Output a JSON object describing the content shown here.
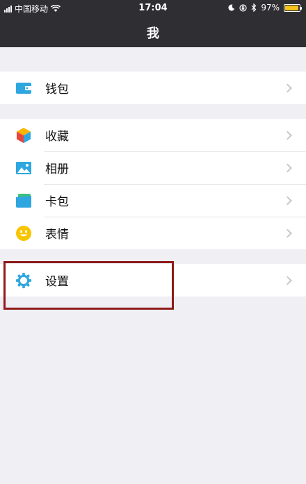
{
  "status_bar": {
    "carrier": "中国移动",
    "time": "17:04",
    "battery_percent": "97%",
    "battery_level": 0.97,
    "icons": [
      "signal-icon",
      "wifi-icon",
      "moon-icon",
      "rotation-lock-icon",
      "bluetooth-icon",
      "battery-icon"
    ]
  },
  "nav": {
    "title": "我"
  },
  "menu": {
    "wallet": {
      "label": "钱包",
      "icon": "wallet-icon"
    },
    "items": [
      {
        "label": "收藏",
        "icon": "favorites-cube-icon"
      },
      {
        "label": "相册",
        "icon": "album-picture-icon"
      },
      {
        "label": "卡包",
        "icon": "card-pack-icon"
      },
      {
        "label": "表情",
        "icon": "smiley-icon"
      }
    ],
    "settings": {
      "label": "设置",
      "icon": "gear-icon"
    }
  },
  "colors": {
    "nav_bg": "#2e2e33",
    "page_bg": "#efeff4",
    "highlight_box": "#8f1a1a",
    "icon_blue": "#2ea7e0"
  }
}
